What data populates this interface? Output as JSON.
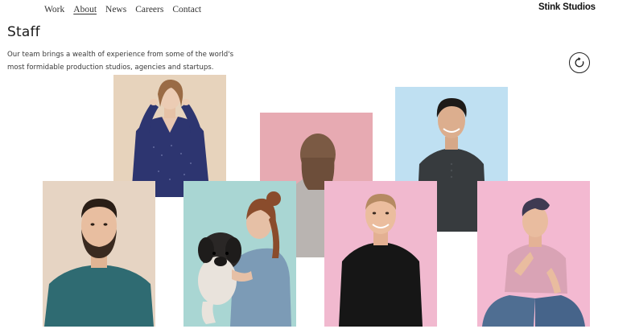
{
  "nav": {
    "items": [
      {
        "label": "Work"
      },
      {
        "label": "About"
      },
      {
        "label": "News"
      },
      {
        "label": "Careers"
      },
      {
        "label": "Contact"
      }
    ]
  },
  "brand": "Stink Studios",
  "page": {
    "title": "Staff",
    "intro": "Our team brings a wealth of experience from some of the world's most formidable production studios, agencies and startups."
  },
  "icons": {
    "refresh": "refresh-icon"
  },
  "staff_photos": [
    {
      "name": "portrait-woman-blue-shirt",
      "background": "#e7d3bc"
    },
    {
      "name": "portrait-person-back",
      "background": "#e7aab2"
    },
    {
      "name": "portrait-man-dark-sweater",
      "background": "#bfe0f2"
    },
    {
      "name": "portrait-bearded-man",
      "background": "#e6d4c3"
    },
    {
      "name": "portrait-woman-with-dog",
      "background": "#a9d6d3"
    },
    {
      "name": "portrait-man-black-sweater",
      "background": "#f1b9cf"
    },
    {
      "name": "portrait-man-pink-shirt",
      "background": "#f3b9d1"
    }
  ]
}
